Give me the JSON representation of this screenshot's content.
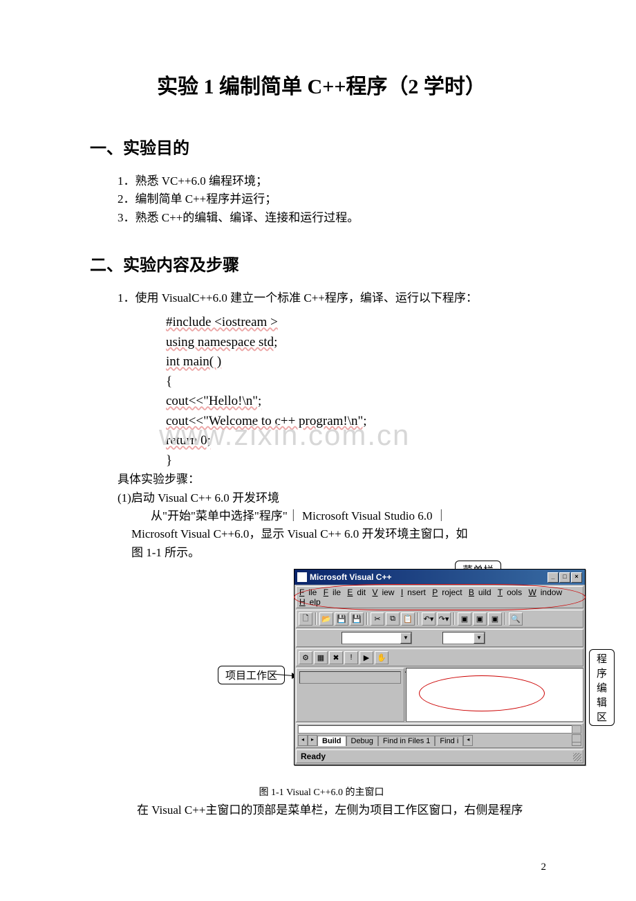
{
  "page_number": "2",
  "title": "实验 1    编制简单 C++程序（2 学时）",
  "section1_heading": "一、实验目的",
  "section1_items": [
    "1．熟悉 VC++6.0 编程环境；",
    "2．编制简单 C++程序并运行；",
    "3．熟悉 C++的编辑、编译、连接和运行过程。"
  ],
  "section2_heading": "二、实验内容及步骤",
  "section2_item1": "1．使用 VisualC++6.0 建立一个标准 C++程序，编译、运行以下程序：",
  "code_lines": [
    "#include <iostream >",
    "using namespace std;",
    "int   main( )",
    "{",
    "  cout<<\"Hello!\\n\";",
    "  cout<<\"Welcome to c++ program!\\n\";",
    "  return 0;",
    "}"
  ],
  "watermark": "www.zixin.com.cn",
  "steps_heading": "具体实验步骤：",
  "step1_title": "(1)启动 Visual C++ 6.0 开发环境",
  "step1_body_l1": "从\"开始\"菜单中选择\"程序\"｜ Microsoft Visual Studio 6.0 ｜",
  "step1_body_l2": "Microsoft Visual C++6.0，显示 Visual C++ 6.0 开发环境主窗口，如",
  "step1_body_l3": "图 1-1 所示。",
  "callouts": {
    "menu_bar": "菜单栏",
    "workspace": "项目工作区",
    "edit_area": "程序编辑区"
  },
  "vc_window": {
    "title": "Microsoft Visual C++",
    "menu": [
      "File",
      "File",
      "Edit",
      "View",
      "Insert",
      "Project",
      "Build",
      "Tools",
      "Window",
      "Help"
    ],
    "toolbar_icons": [
      "new",
      "open",
      "save",
      "save-all",
      "sep",
      "cut",
      "copy",
      "paste",
      "sep",
      "undo",
      "redo",
      "sep",
      "win1",
      "win2",
      "win3",
      "sep",
      "find"
    ],
    "toolbar2_icons": [
      "compile",
      "build",
      "stop-build",
      "execute",
      "go",
      "insert-bp"
    ],
    "output_tabs": [
      "Build",
      "Debug",
      "Find in Files 1",
      "Find i"
    ],
    "status": "Ready"
  },
  "figure_caption": "图 1-1 Visual C++6.0 的主窗口",
  "after_figure_text": "在 Visual C++主窗口的顶部是菜单栏，左侧为项目工作区窗口，右侧是程序"
}
